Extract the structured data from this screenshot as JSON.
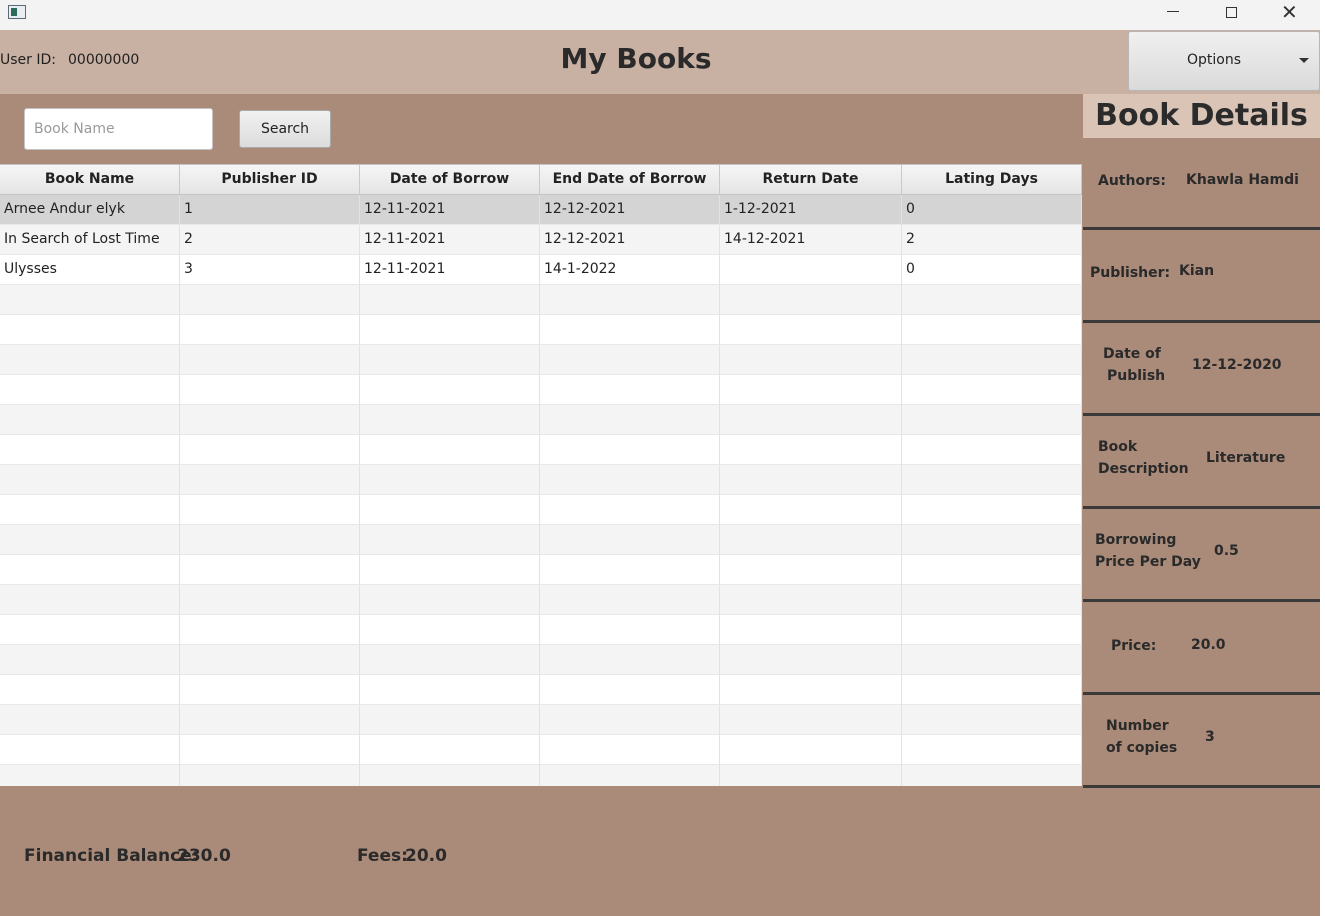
{
  "window": {
    "icon": "app-window-icon",
    "controls": [
      "minimize-icon",
      "maximize-icon",
      "close-icon"
    ]
  },
  "header": {
    "user_id_label": "User ID:",
    "user_id_value": "00000000",
    "title": "My Books",
    "options_label": "Options"
  },
  "search": {
    "placeholder": "Book Name",
    "value": "",
    "button_label": "Search"
  },
  "table": {
    "columns": [
      "Book Name",
      "Publisher ID",
      "Date of Borrow",
      "End Date of Borrow",
      "Return Date",
      "Lating Days"
    ],
    "rows": [
      [
        "Arnee Andur elyk",
        "1",
        "12-11-2021",
        "12-12-2021",
        "1-12-2021",
        "0"
      ],
      [
        "In Search of Lost Time",
        "2",
        "12-11-2021",
        "12-12-2021",
        "14-12-2021",
        "2"
      ],
      [
        "Ulysses",
        "3",
        "12-11-2021",
        "14-1-2022",
        "",
        "0"
      ]
    ],
    "selected_row": 0
  },
  "details": {
    "title": "Book Details",
    "authors_label": "Authors:",
    "authors_value": "Khawla Hamdi",
    "publisher_label": "Publisher:",
    "publisher_value": "Kian",
    "date_label_1": "Date of",
    "date_label_2": "Publish",
    "date_value": "12-12-2020",
    "description_label_1": "Book",
    "description_label_2": "Description",
    "description_value": "Literature",
    "borrow_price_label_1": "Borrowing",
    "borrow_price_label_2": "Price Per Day",
    "borrow_price_value": "0.5",
    "price_label": "Price:",
    "price_value": "20.0",
    "copies_label_1": "Number",
    "copies_label_2": "of copies",
    "copies_value": "3"
  },
  "footer": {
    "balance_label": "Financial Balance:",
    "balance_value": "230.0",
    "fees_label": "Fees:",
    "fees_value": "20.0"
  },
  "colors": {
    "header_bg": "#c8b1a2",
    "main_bg": "#aa8b7a",
    "details_title_bg": "#d9c4b6"
  }
}
